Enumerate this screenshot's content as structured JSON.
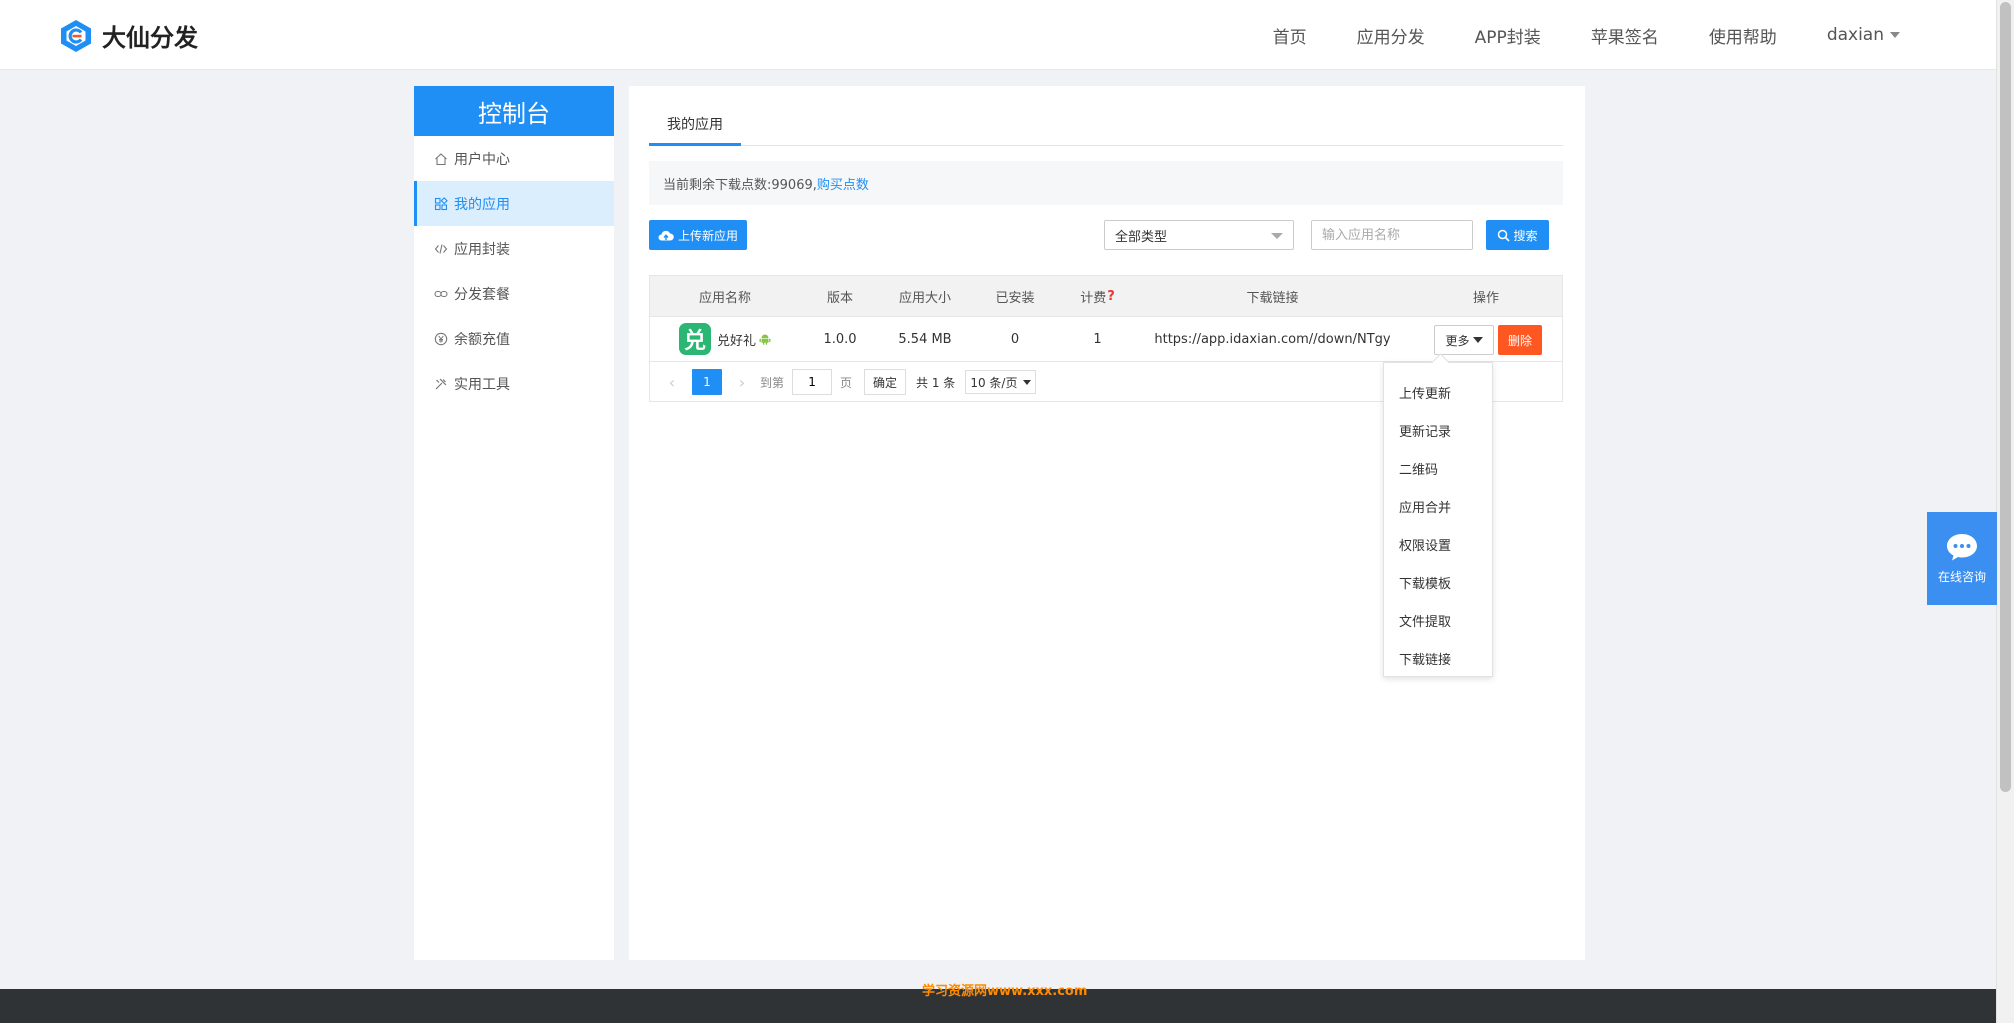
{
  "header": {
    "brand": "大仙分发",
    "nav": [
      "首页",
      "应用分发",
      "APP封装",
      "苹果签名",
      "使用帮助"
    ],
    "user": "daxian",
    "brand_color": "#1f8ff5"
  },
  "sidebar": {
    "title": "控制台",
    "items": [
      {
        "label": "用户中心",
        "icon": "home-icon"
      },
      {
        "label": "我的应用",
        "icon": "apps-icon",
        "active": true
      },
      {
        "label": "应用封装",
        "icon": "code-icon"
      },
      {
        "label": "分发套餐",
        "icon": "link-icon"
      },
      {
        "label": "余额充值",
        "icon": "yen-icon"
      },
      {
        "label": "实用工具",
        "icon": "tools-icon"
      }
    ]
  },
  "main": {
    "tab": "我的应用",
    "notice": {
      "text": "当前剩余下载点数:99069,",
      "link": "购买点数"
    },
    "toolbar": {
      "upload_label": "上传新应用",
      "type_select": "全部类型",
      "search_placeholder": "输入应用名称",
      "search_label": "搜索"
    },
    "table": {
      "columns": [
        "应用名称",
        "版本",
        "应用大小",
        "已安装",
        "计费",
        "下载链接",
        "操作"
      ],
      "rows": [
        {
          "icon_char": "兑",
          "name": "兑好礼",
          "version": "1.0.0",
          "size": "5.54 MB",
          "installed": "0",
          "billing": "1",
          "link": "https://app.idaxian.com//down/NTgy",
          "more_label": "更多",
          "delete_label": "删除"
        }
      ]
    },
    "pager": {
      "current": "1",
      "goto_label": "到第",
      "goto_value": "1",
      "page_label": "页",
      "ok_label": "确定",
      "total": "共 1 条",
      "limit": "10 条/页"
    },
    "dropdown": [
      "上传更新",
      "更新记录",
      "二维码",
      "应用合并",
      "权限设置",
      "下载模板",
      "文件提取",
      "下载链接"
    ]
  },
  "chat": {
    "label": "在线咨询"
  },
  "watermark": "学习资源网www.xxx.com",
  "colors": {
    "accent": "#1f8ff5",
    "danger": "#ff5722",
    "chat": "#3b8ff0",
    "footer": "#2f3336"
  }
}
